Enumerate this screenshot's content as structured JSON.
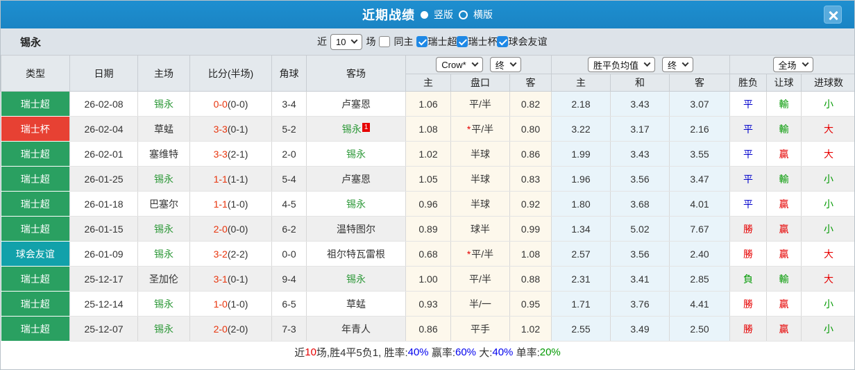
{
  "titlebar": {
    "title": "近期战绩",
    "vertical_label": "竖版",
    "horizontal_label": "横版"
  },
  "filterbar": {
    "team": "锡永",
    "recent_label": "近",
    "recent_count": "10",
    "matches_label": "场",
    "same_home_label": "同主",
    "leagues": [
      "瑞士超",
      "瑞士杯",
      "球会友谊"
    ]
  },
  "table": {
    "main_columns": [
      "类型",
      "日期",
      "主场",
      "比分(半场)",
      "角球",
      "客场"
    ],
    "sub_columns": [
      "主",
      "盘口",
      "客",
      "主",
      "和",
      "客",
      "胜负",
      "让球",
      "进球数"
    ],
    "odds_source_select": "Crow*",
    "odds_time_select": "终",
    "avg_select": "胜平负均值",
    "avg_time_select": "终",
    "scope_select": "全场",
    "rows": [
      {
        "type": "瑞士超",
        "type_color": "green",
        "date": "26-02-08",
        "home_team": "锡永",
        "home_is_self": true,
        "score_full": "0-0",
        "score_half": "(0-0)",
        "corner": "3-4",
        "away_team": "卢塞恩",
        "away_is_self": false,
        "away_card": null,
        "crow_home": "1.06",
        "handicap": "平/半",
        "handicap_star": false,
        "crow_away": "0.82",
        "avg_home": "2.18",
        "avg_draw": "3.43",
        "avg_away": "3.07",
        "result": "平",
        "result_color": "blue",
        "handicap_result": "輸",
        "handicap_result_color": "green",
        "goals": "小",
        "goals_color": "green"
      },
      {
        "type": "瑞士杯",
        "type_color": "red",
        "date": "26-02-04",
        "home_team": "草蜢",
        "home_is_self": false,
        "score_full": "3-3",
        "score_half": "(0-1)",
        "corner": "5-2",
        "away_team": "锡永",
        "away_is_self": true,
        "away_card": "1",
        "crow_home": "1.08",
        "handicap": "平/半",
        "handicap_star": true,
        "crow_away": "0.80",
        "avg_home": "3.22",
        "avg_draw": "3.17",
        "avg_away": "2.16",
        "result": "平",
        "result_color": "blue",
        "handicap_result": "輸",
        "handicap_result_color": "green",
        "goals": "大",
        "goals_color": "red"
      },
      {
        "type": "瑞士超",
        "type_color": "green",
        "date": "26-02-01",
        "home_team": "塞维特",
        "home_is_self": false,
        "score_full": "3-3",
        "score_half": "(2-1)",
        "corner": "2-0",
        "away_team": "锡永",
        "away_is_self": true,
        "away_card": null,
        "crow_home": "1.02",
        "handicap": "半球",
        "handicap_star": false,
        "crow_away": "0.86",
        "avg_home": "1.99",
        "avg_draw": "3.43",
        "avg_away": "3.55",
        "result": "平",
        "result_color": "blue",
        "handicap_result": "贏",
        "handicap_result_color": "red",
        "goals": "大",
        "goals_color": "red"
      },
      {
        "type": "瑞士超",
        "type_color": "green",
        "date": "26-01-25",
        "home_team": "锡永",
        "home_is_self": true,
        "score_full": "1-1",
        "score_half": "(1-1)",
        "corner": "5-4",
        "away_team": "卢塞恩",
        "away_is_self": false,
        "away_card": null,
        "crow_home": "1.05",
        "handicap": "半球",
        "handicap_star": false,
        "crow_away": "0.83",
        "avg_home": "1.96",
        "avg_draw": "3.56",
        "avg_away": "3.47",
        "result": "平",
        "result_color": "blue",
        "handicap_result": "輸",
        "handicap_result_color": "green",
        "goals": "小",
        "goals_color": "green"
      },
      {
        "type": "瑞士超",
        "type_color": "green",
        "date": "26-01-18",
        "home_team": "巴塞尔",
        "home_is_self": false,
        "score_full": "1-1",
        "score_half": "(1-0)",
        "corner": "4-5",
        "away_team": "锡永",
        "away_is_self": true,
        "away_card": null,
        "crow_home": "0.96",
        "handicap": "半球",
        "handicap_star": false,
        "crow_away": "0.92",
        "avg_home": "1.80",
        "avg_draw": "3.68",
        "avg_away": "4.01",
        "result": "平",
        "result_color": "blue",
        "handicap_result": "贏",
        "handicap_result_color": "red",
        "goals": "小",
        "goals_color": "green"
      },
      {
        "type": "瑞士超",
        "type_color": "green",
        "date": "26-01-15",
        "home_team": "锡永",
        "home_is_self": true,
        "score_full": "2-0",
        "score_half": "(0-0)",
        "corner": "6-2",
        "away_team": "温特图尔",
        "away_is_self": false,
        "away_card": null,
        "crow_home": "0.89",
        "handicap": "球半",
        "handicap_star": false,
        "crow_away": "0.99",
        "avg_home": "1.34",
        "avg_draw": "5.02",
        "avg_away": "7.67",
        "result": "勝",
        "result_color": "red",
        "handicap_result": "贏",
        "handicap_result_color": "red",
        "goals": "小",
        "goals_color": "green"
      },
      {
        "type": "球会友谊",
        "type_color": "teal",
        "date": "26-01-09",
        "home_team": "锡永",
        "home_is_self": true,
        "score_full": "3-2",
        "score_half": "(2-2)",
        "corner": "0-0",
        "away_team": "祖尔特瓦雷根",
        "away_is_self": false,
        "away_card": null,
        "crow_home": "0.68",
        "handicap": "平/半",
        "handicap_star": true,
        "crow_away": "1.08",
        "avg_home": "2.57",
        "avg_draw": "3.56",
        "avg_away": "2.40",
        "result": "勝",
        "result_color": "red",
        "handicap_result": "贏",
        "handicap_result_color": "red",
        "goals": "大",
        "goals_color": "red"
      },
      {
        "type": "瑞士超",
        "type_color": "green",
        "date": "25-12-17",
        "home_team": "圣加伦",
        "home_is_self": false,
        "score_full": "3-1",
        "score_half": "(0-1)",
        "corner": "9-4",
        "away_team": "锡永",
        "away_is_self": true,
        "away_card": null,
        "crow_home": "1.00",
        "handicap": "平/半",
        "handicap_star": false,
        "crow_away": "0.88",
        "avg_home": "2.31",
        "avg_draw": "3.41",
        "avg_away": "2.85",
        "result": "負",
        "result_color": "green",
        "handicap_result": "輸",
        "handicap_result_color": "green",
        "goals": "大",
        "goals_color": "red"
      },
      {
        "type": "瑞士超",
        "type_color": "green",
        "date": "25-12-14",
        "home_team": "锡永",
        "home_is_self": true,
        "score_full": "1-0",
        "score_half": "(1-0)",
        "corner": "6-5",
        "away_team": "草蜢",
        "away_is_self": false,
        "away_card": null,
        "crow_home": "0.93",
        "handicap": "半/一",
        "handicap_star": false,
        "crow_away": "0.95",
        "avg_home": "1.71",
        "avg_draw": "3.76",
        "avg_away": "4.41",
        "result": "勝",
        "result_color": "red",
        "handicap_result": "贏",
        "handicap_result_color": "red",
        "goals": "小",
        "goals_color": "green"
      },
      {
        "type": "瑞士超",
        "type_color": "green",
        "date": "25-12-07",
        "home_team": "锡永",
        "home_is_self": true,
        "score_full": "2-0",
        "score_half": "(2-0)",
        "corner": "7-3",
        "away_team": "年青人",
        "away_is_self": false,
        "away_card": null,
        "crow_home": "0.86",
        "handicap": "平手",
        "handicap_star": false,
        "crow_away": "1.02",
        "avg_home": "2.55",
        "avg_draw": "3.49",
        "avg_away": "2.50",
        "result": "勝",
        "result_color": "red",
        "handicap_result": "贏",
        "handicap_result_color": "red",
        "goals": "小",
        "goals_color": "green"
      }
    ]
  },
  "summary": {
    "segments": [
      {
        "text": "近",
        "color": "#333333"
      },
      {
        "text": "10",
        "color": "#e60000"
      },
      {
        "text": "场,胜4平5负1, 胜率:",
        "color": "#333333"
      },
      {
        "text": "40%",
        "color": "#0000ee"
      },
      {
        "text": " 赢率:",
        "color": "#333333"
      },
      {
        "text": "60%",
        "color": "#0000ee"
      },
      {
        "text": " 大:",
        "color": "#333333"
      },
      {
        "text": "40%",
        "color": "#0000ee"
      },
      {
        "text": " 单率:",
        "color": "#333333"
      },
      {
        "text": "20%",
        "color": "#009900"
      }
    ]
  },
  "palette": {
    "league": {
      "green": "#2aa061",
      "red": "#e74133",
      "teal": "#12a1aa"
    },
    "value": {
      "red": "#e60000",
      "green": "#009900",
      "blue": "#0000cc"
    },
    "self_team": "#2e9939",
    "score_red": "#e8340c",
    "titlebar_blue": "#1b86c7"
  }
}
